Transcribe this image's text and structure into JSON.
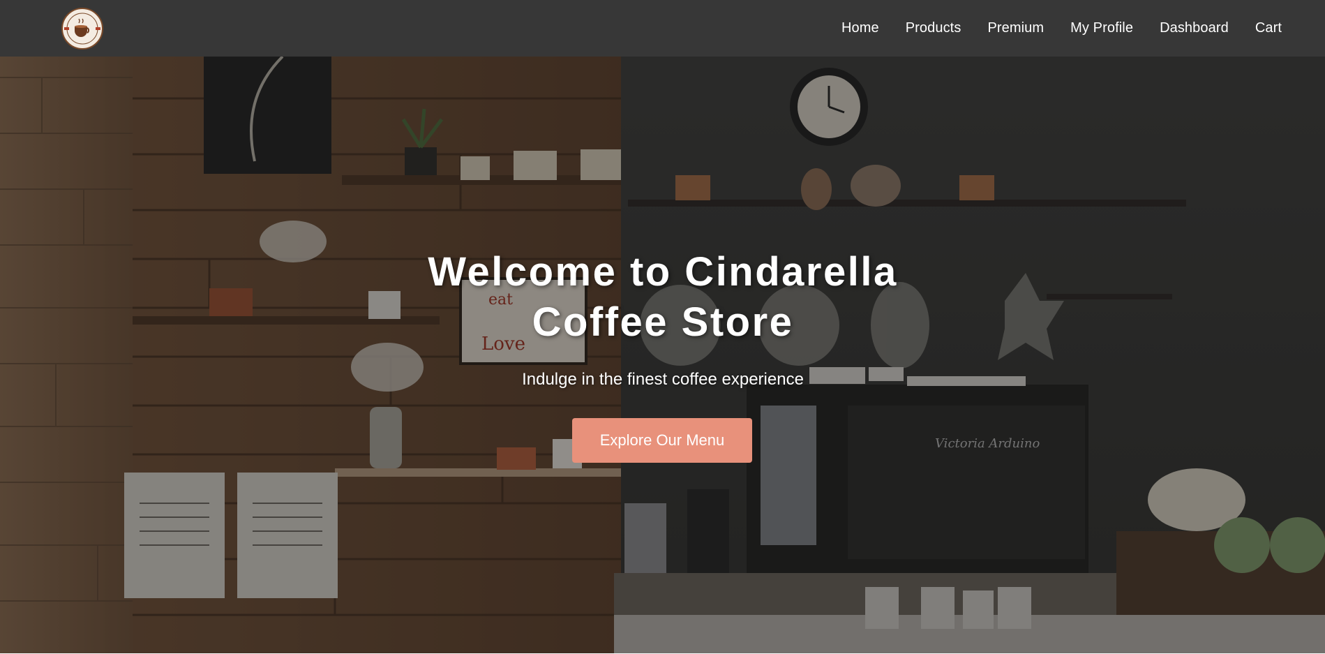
{
  "brand": {
    "logo_icon": "coffee-cup-logo-icon",
    "logo_text_top": "COFFEE SHOP",
    "logo_text_bottom": "COFFEE SHOP"
  },
  "nav": {
    "items": [
      {
        "label": "Home"
      },
      {
        "label": "Products"
      },
      {
        "label": "Premium"
      },
      {
        "label": "My Profile"
      },
      {
        "label": "Dashboard"
      },
      {
        "label": "Cart"
      }
    ]
  },
  "hero": {
    "title_line1": "Welcome to Cindarella",
    "title_line2": "Coffee Store",
    "subtitle": "Indulge in the finest coffee experience",
    "cta_label": "Explore Our Menu",
    "background": "coffee-shop-interior-photo"
  },
  "colors": {
    "navbar": "#373737",
    "cta": "#e8917b",
    "text": "#ffffff"
  }
}
